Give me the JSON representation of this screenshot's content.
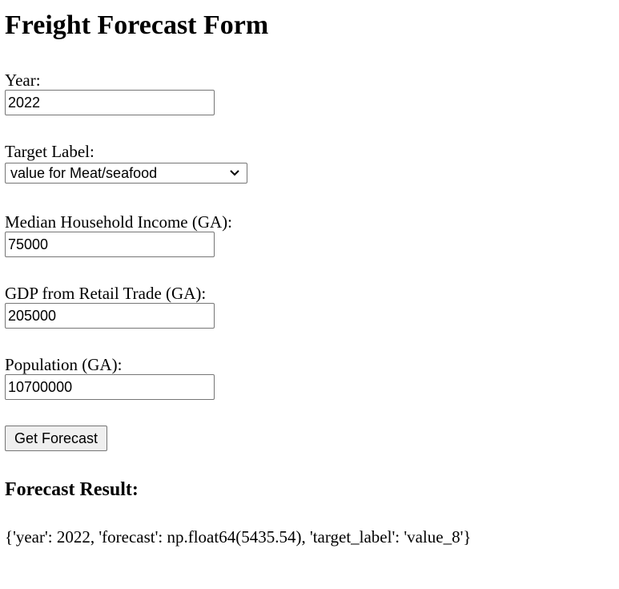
{
  "page": {
    "title": "Freight Forecast Form"
  },
  "form": {
    "year": {
      "label": "Year:",
      "value": "2022"
    },
    "target_label": {
      "label": "Target Label:",
      "selected": "value for Meat/seafood"
    },
    "median_income": {
      "label": "Median Household Income (GA):",
      "value": "75000"
    },
    "gdp_retail": {
      "label": "GDP from Retail Trade (GA):",
      "value": "205000"
    },
    "population": {
      "label": "Population (GA):",
      "value": "10700000"
    },
    "submit_label": "Get Forecast"
  },
  "result": {
    "heading": "Forecast Result:",
    "text": "{'year': 2022, 'forecast': np.float64(5435.54), 'target_label': 'value_8'}"
  },
  "icons": {
    "select_arrow": "chevron-down-icon"
  }
}
